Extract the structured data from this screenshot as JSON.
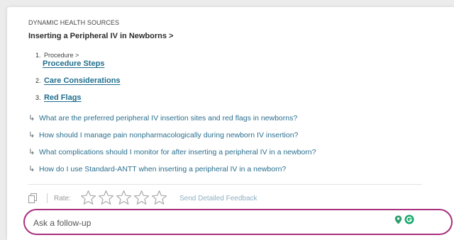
{
  "source_label": "DYNAMIC HEALTH SOURCES",
  "article_title": "Inserting a Peripheral IV in Newborns >",
  "sections": [
    {
      "num": "1.",
      "prefix": "Procedure >",
      "label": "Procedure Steps"
    },
    {
      "num": "2.",
      "label": "Care Considerations"
    },
    {
      "num": "3.",
      "label": "Red Flags"
    }
  ],
  "follow_ups": [
    "What are the preferred peripheral IV insertion sites and red flags in newborns?",
    "How should I manage pain nonpharmacologically during newborn IV insertion?",
    "What complications should I monitor for after inserting a peripheral IV in a newborn?",
    "How do I use Standard-ANTT when inserting a peripheral IV in a newborn?"
  ],
  "follow_up_arrow": "↳",
  "rating": {
    "label": "Rate:",
    "stars": 5,
    "filled": 0
  },
  "feedback_label": "Send Detailed Feedback",
  "ask": {
    "placeholder": "Ask a follow-up",
    "value": ""
  },
  "colors": {
    "link": "#1f6e8c",
    "followup": "#2a6f8e",
    "ask_border": "#a8307d",
    "pin": "#2e9d6b",
    "grammarly": "#15a86a"
  },
  "icons": {
    "copy": "copy-icon",
    "star": "star-outline-icon",
    "pin": "location-pin-icon",
    "grammarly": "grammarly-icon"
  }
}
